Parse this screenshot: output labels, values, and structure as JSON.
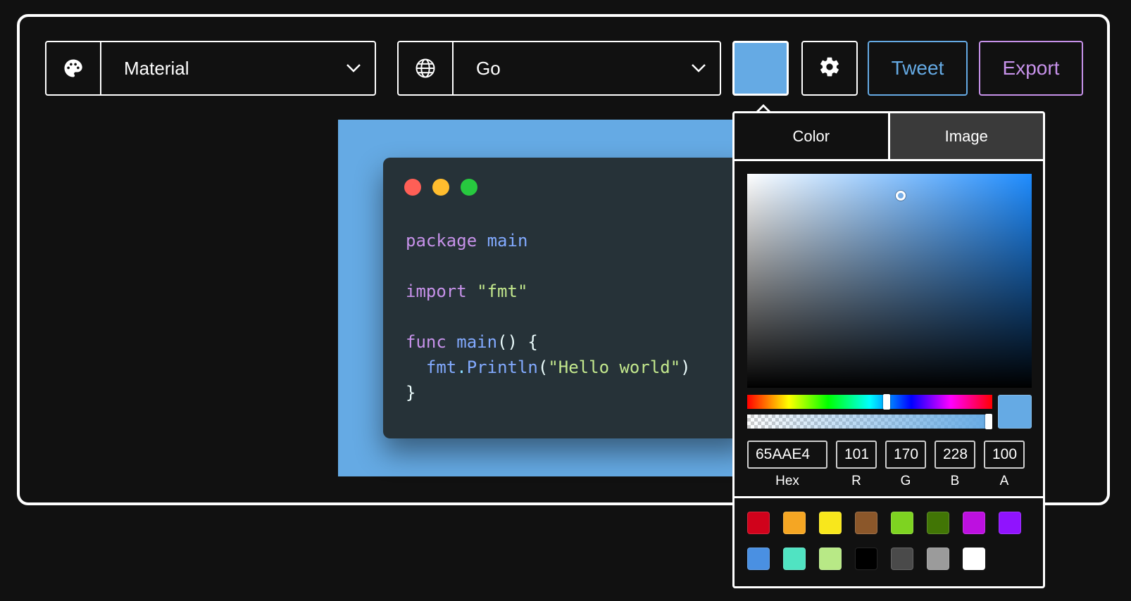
{
  "toolbar": {
    "theme_select": {
      "label": "Material",
      "icon": "palette-icon"
    },
    "language_select": {
      "label": "Go",
      "icon": "globe-icon"
    },
    "background_color": "#65AAE4",
    "settings_icon": "gear-icon",
    "tweet_label": "Tweet",
    "export_label": "Export",
    "tweet_color": "#65AAE4",
    "export_color": "#C792EA"
  },
  "window": {
    "dots": [
      "#FF5F56",
      "#FFBD2E",
      "#27C93F"
    ],
    "code_lines": [
      "package main",
      "",
      "import \"fmt\"",
      "",
      "func main() {",
      "  fmt.Println(\"Hello world\")",
      "}"
    ]
  },
  "picker": {
    "tabs": [
      {
        "label": "Color",
        "active": true
      },
      {
        "label": "Image",
        "active": false
      }
    ],
    "hex": "65AAE4",
    "r": "101",
    "g": "170",
    "b": "228",
    "a": "100",
    "labels": {
      "hex": "Hex",
      "r": "R",
      "g": "G",
      "b": "B",
      "a": "A"
    },
    "hue_position": 0.57,
    "alpha_position": 1.0,
    "presets": [
      "#D0021B",
      "#F5A623",
      "#F8E71C",
      "#8B572A",
      "#7ED321",
      "#417505",
      "#BD10E0",
      "#9013FE",
      "#4A90E2",
      "#50E3C2",
      "#B8E986",
      "#000000",
      "#4A4A4A",
      "#9B9B9B",
      "#FFFFFF"
    ]
  }
}
